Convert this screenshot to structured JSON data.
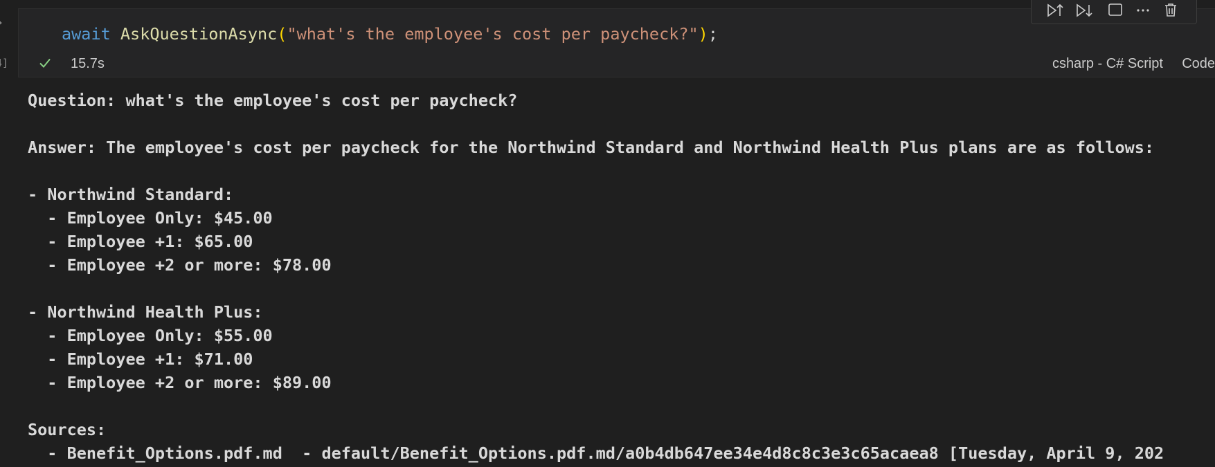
{
  "gutter": {
    "execution_count": "4]"
  },
  "cell": {
    "code": {
      "keyword": "await",
      "function": "AskQuestionAsync",
      "open_paren": "(",
      "string": "\"what's the employee's cost per paycheck?\"",
      "close_paren": ")",
      "semicolon": ";"
    },
    "status": {
      "state": "success",
      "elapsed": "15.7s"
    },
    "kernel": "csharp - C# Script",
    "language": "Code",
    "toolbar": [
      "execute-above-icon",
      "execute-below-icon",
      "split-cell-icon",
      "more-actions-icon",
      "delete-icon"
    ]
  },
  "output": {
    "lines": [
      "Question: what's the employee's cost per paycheck?",
      "",
      "Answer: The employee's cost per paycheck for the Northwind Standard and Northwind Health Plus plans are as follows:",
      "",
      "- Northwind Standard:",
      "  - Employee Only: $45.00",
      "  - Employee +1: $65.00",
      "  - Employee +2 or more: $78.00",
      "",
      "- Northwind Health Plus:",
      "  - Employee Only: $55.00",
      "  - Employee +1: $71.00",
      "  - Employee +2 or more: $89.00",
      "",
      "Sources:",
      "  - Benefit_Options.pdf.md  - default/Benefit_Options.pdf.md/a0b4db647ee34e4d8c8c3e3c65acaea8 [Tuesday, April 9, 202"
    ]
  },
  "colors": {
    "background": "#1f1f1f",
    "cell_background": "#252526",
    "keyword": "#569cd6",
    "function": "#dcdcaa",
    "string": "#ce9178",
    "bracket": "#ffd700",
    "success": "#89d185"
  }
}
